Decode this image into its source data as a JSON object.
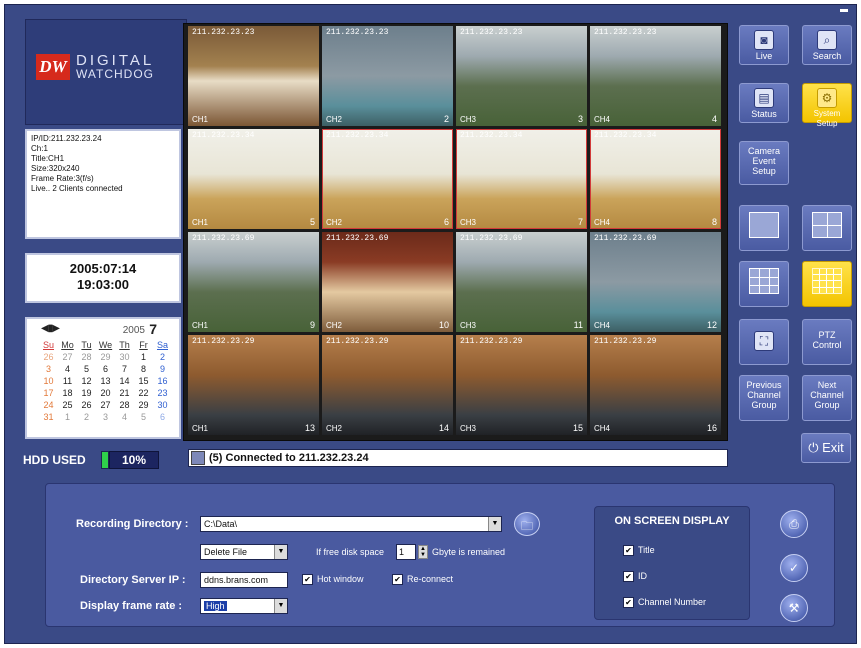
{
  "left": {
    "logo_badge": "DW",
    "logo_line1": "DIGITAL",
    "logo_line2": "WATCHDOG",
    "info_lines": [
      "IP/ID:211.232.23.24",
      "Ch:1",
      "Title:CH1",
      "Size:320x240",
      "Frame Rate:3(f/s)",
      "Live.. 2 Clients connected"
    ],
    "date": "2005:07:14",
    "time": "19:03:00",
    "calendar": {
      "nav": "◀▮▶",
      "year": "2005",
      "month": "7",
      "weekdays": [
        "Su",
        "Mo",
        "Tu",
        "We",
        "Th",
        "Fr",
        "Sa"
      ],
      "weeks": [
        [
          "26",
          "27",
          "28",
          "29",
          "30",
          "1",
          "2"
        ],
        [
          "3",
          "4",
          "5",
          "6",
          "7",
          "8",
          "9"
        ],
        [
          "10",
          "11",
          "12",
          "13",
          "14",
          "15",
          "16"
        ],
        [
          "17",
          "18",
          "19",
          "20",
          "21",
          "22",
          "23"
        ],
        [
          "24",
          "25",
          "26",
          "27",
          "28",
          "29",
          "30"
        ],
        [
          "31",
          "1",
          "2",
          "3",
          "4",
          "5",
          "6"
        ]
      ]
    },
    "hdd_label": "HDD USED",
    "hdd_value": "10%"
  },
  "tiles": [
    {
      "ip": "211.232.23.23",
      "ch": "CH1",
      "num": "",
      "scene": "kitchen"
    },
    {
      "ip": "211.232.23.23",
      "ch": "CH2",
      "num": "2",
      "scene": "aqua"
    },
    {
      "ip": "211.232.23.23",
      "ch": "CH3",
      "num": "3",
      "scene": "parking"
    },
    {
      "ip": "211.232.23.23",
      "ch": "CH4",
      "num": "4",
      "scene": "parking"
    },
    {
      "ip": "211.232.23.34",
      "ch": "CH1",
      "num": "5",
      "scene": "office"
    },
    {
      "ip": "211.232.23.34",
      "ch": "CH2",
      "num": "6",
      "scene": "office"
    },
    {
      "ip": "211.232.23.34",
      "ch": "CH3",
      "num": "7",
      "scene": "office"
    },
    {
      "ip": "211.232.23.34",
      "ch": "CH4",
      "num": "8",
      "scene": "office"
    },
    {
      "ip": "211.232.23.69",
      "ch": "CH1",
      "num": "9",
      "scene": "parking"
    },
    {
      "ip": "211.232.23.69",
      "ch": "CH2",
      "num": "10",
      "scene": "person"
    },
    {
      "ip": "211.232.23.69",
      "ch": "CH3",
      "num": "11",
      "scene": "parking"
    },
    {
      "ip": "211.232.23.69",
      "ch": "CH4",
      "num": "12",
      "scene": "aqua"
    },
    {
      "ip": "211.232.23.29",
      "ch": "CH1",
      "num": "13",
      "scene": "kid"
    },
    {
      "ip": "211.232.23.29",
      "ch": "CH2",
      "num": "14",
      "scene": "kid"
    },
    {
      "ip": "211.232.23.29",
      "ch": "CH3",
      "num": "15",
      "scene": "kid"
    },
    {
      "ip": "211.232.23.29",
      "ch": "CH4",
      "num": "16",
      "scene": "kid"
    }
  ],
  "status_text": "(5) Connected to 211.232.23.24",
  "right_buttons": {
    "live": "Live",
    "search": "Search",
    "status": "Status",
    "system_setup": "System Setup",
    "camera_event": "Camera Event Setup",
    "ptz": "PTZ Control",
    "prev_group": "Previous Channel Group",
    "next_group": "Next Channel Group",
    "exit": "Exit"
  },
  "settings": {
    "recording_dir_label": "Recording Directory :",
    "recording_dir_value": "C:\\Data\\",
    "delete_option": "Delete File",
    "free_space_pre": "If free disk space",
    "free_space_value": "1",
    "free_space_post": "Gbyte is remained",
    "dir_server_label": "Directory Server IP :",
    "dir_server_value": "ddns.brans.com",
    "hot_window": "Hot window",
    "reconnect": "Re-connect",
    "frame_rate_label": "Display frame rate :",
    "frame_rate_value": "High"
  },
  "osd": {
    "title": "ON SCREEN DISPLAY",
    "title_opt": "Title",
    "id_opt": "ID",
    "channel_opt": "Channel Number"
  },
  "colors": {
    "app_bg": "#3a4a86",
    "accent_yellow": "#ffe24a",
    "selected_border": "#d23a3a"
  }
}
